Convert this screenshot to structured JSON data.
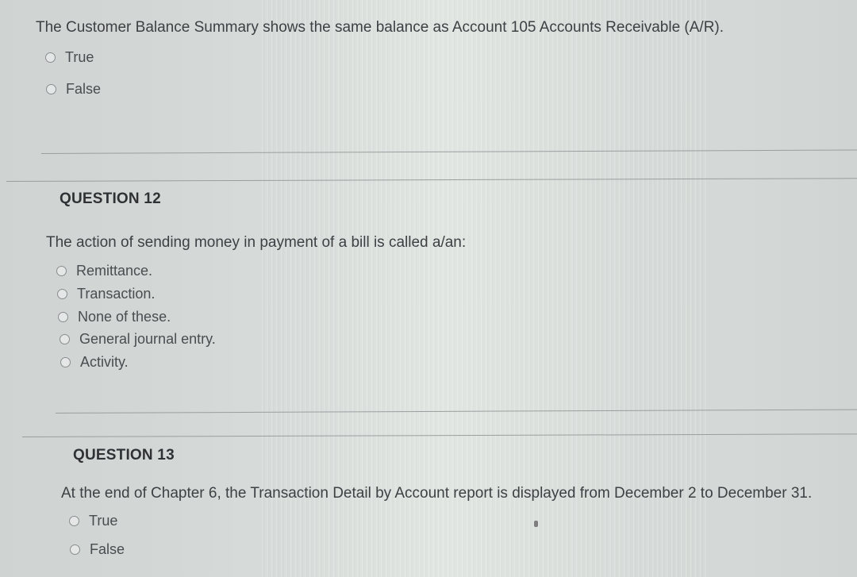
{
  "question_11": {
    "text": "The Customer Balance Summary shows the same balance as Account 105 Accounts Receivable (A/R).",
    "options": [
      "True",
      "False"
    ]
  },
  "question_12": {
    "heading": "QUESTION 12",
    "text": "The action of sending money in payment of a bill is called a/an:",
    "options": [
      "Remittance.",
      "Transaction.",
      "None of these.",
      "General journal entry.",
      "Activity."
    ]
  },
  "question_13": {
    "heading": "QUESTION 13",
    "text": "At the end of Chapter 6, the Transaction Detail by Account report is displayed from December 2 to December 31.",
    "options": [
      "True",
      "False"
    ]
  }
}
